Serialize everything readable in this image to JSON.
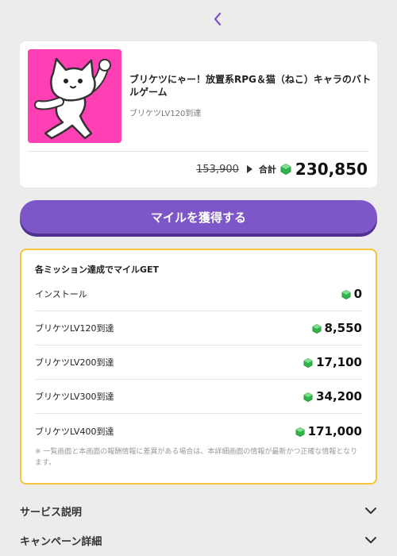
{
  "nav": {
    "back_icon": "chevron-left-icon",
    "accent": "#7d57c7"
  },
  "offer": {
    "title": "ブリケツにゃー！放置系RPG＆猫（ねこ）キャラのバトルゲーム",
    "subtitle": "ブリケツLV120到達",
    "original_price": "153,900",
    "total_label": "合計",
    "total_value": "230,850",
    "thumb_color": "#ff3fb4"
  },
  "cta": {
    "label": "マイルを獲得する",
    "color": "#7d57c7"
  },
  "missions": {
    "heading": "各ミッション達成でマイルGET",
    "items": [
      {
        "label": "インストール",
        "value": "0"
      },
      {
        "label": "ブリケツLV120到達",
        "value": "8,550"
      },
      {
        "label": "ブリケツLV200到達",
        "value": "17,100"
      },
      {
        "label": "ブリケツLV300到達",
        "value": "34,200"
      },
      {
        "label": "ブリケツLV400到達",
        "value": "171,000"
      }
    ],
    "note": "※ 一覧画面と本画面の報酬情報に差異がある場合は、本詳細画面の情報が最新かつ正確な情報となります。",
    "border_color": "#f3c53a"
  },
  "sections": [
    {
      "label": "サービス説明"
    },
    {
      "label": "キャンペーン詳細"
    }
  ]
}
